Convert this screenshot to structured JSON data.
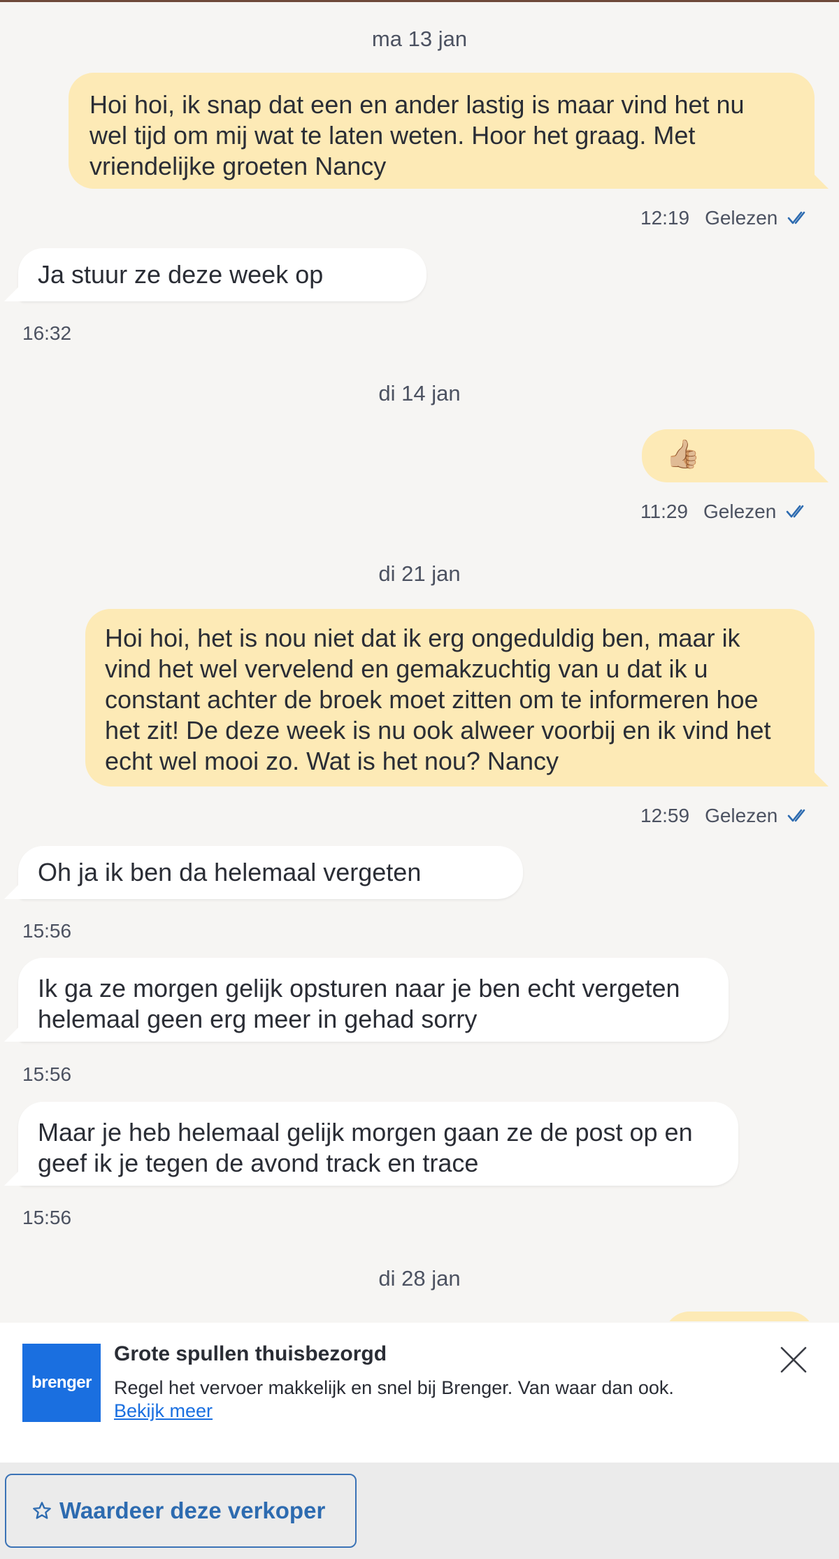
{
  "messages": {
    "date1": "ma 13 jan",
    "msg1": "Hoi hoi, ik snap dat een en ander lastig is maar vind het nu\nwel tijd om mij wat te laten weten. Hoor het graag. Met\nvriendelijke groeten Nancy",
    "msg1_time": "12:19",
    "msg1_status": "Gelezen",
    "msg2": "Ja stuur ze deze week op",
    "msg2_time": "16:32",
    "date2": "di 14 jan",
    "msg3_emoji": "👍🏼",
    "msg3_time": "11:29",
    "msg3_status": "Gelezen",
    "date3": "di 21 jan",
    "msg4": "Hoi hoi, het is nou niet dat ik erg ongeduldig ben, maar ik\nvind het wel vervelend en gemakzuchtig van u dat ik u\nconstant achter de broek moet zitten om te informeren hoe\nhet zit! De deze week is nu ook alweer voorbij en ik vind het\necht wel mooi zo. Wat is het nou? Nancy",
    "msg4_time": "12:59",
    "msg4_status": "Gelezen",
    "msg5": "Oh ja ik ben da helemaal vergeten",
    "msg5_time": "15:56",
    "msg6": "Ik ga ze morgen gelijk opsturen naar je ben echt vergeten\nhelemaal geen erg meer in gehad sorry",
    "msg6_time": "15:56",
    "msg7": "Maar je heb helemaal gelijk morgen gaan ze de post op en\ngeef ik je tegen de avond track en trace",
    "msg7_time": "15:56",
    "date4": "di 28 jan"
  },
  "ad": {
    "logo_text": "brenger",
    "title": "Grote spullen thuisbezorgd",
    "text": "Regel het vervoer makkelijk en snel bij Brenger. Van waar dan ook.",
    "link": "Bekijk meer"
  },
  "footer": {
    "rate_label": "Waardeer deze verkoper"
  },
  "colors": {
    "outgoing_bubble": "#fdeab6",
    "incoming_bubble": "#ffffff",
    "read_check": "#2d6bb0",
    "brand_blue": "#1a6fe0"
  },
  "icons": [
    "double-check-icon",
    "close-icon",
    "star-outline-icon"
  ]
}
